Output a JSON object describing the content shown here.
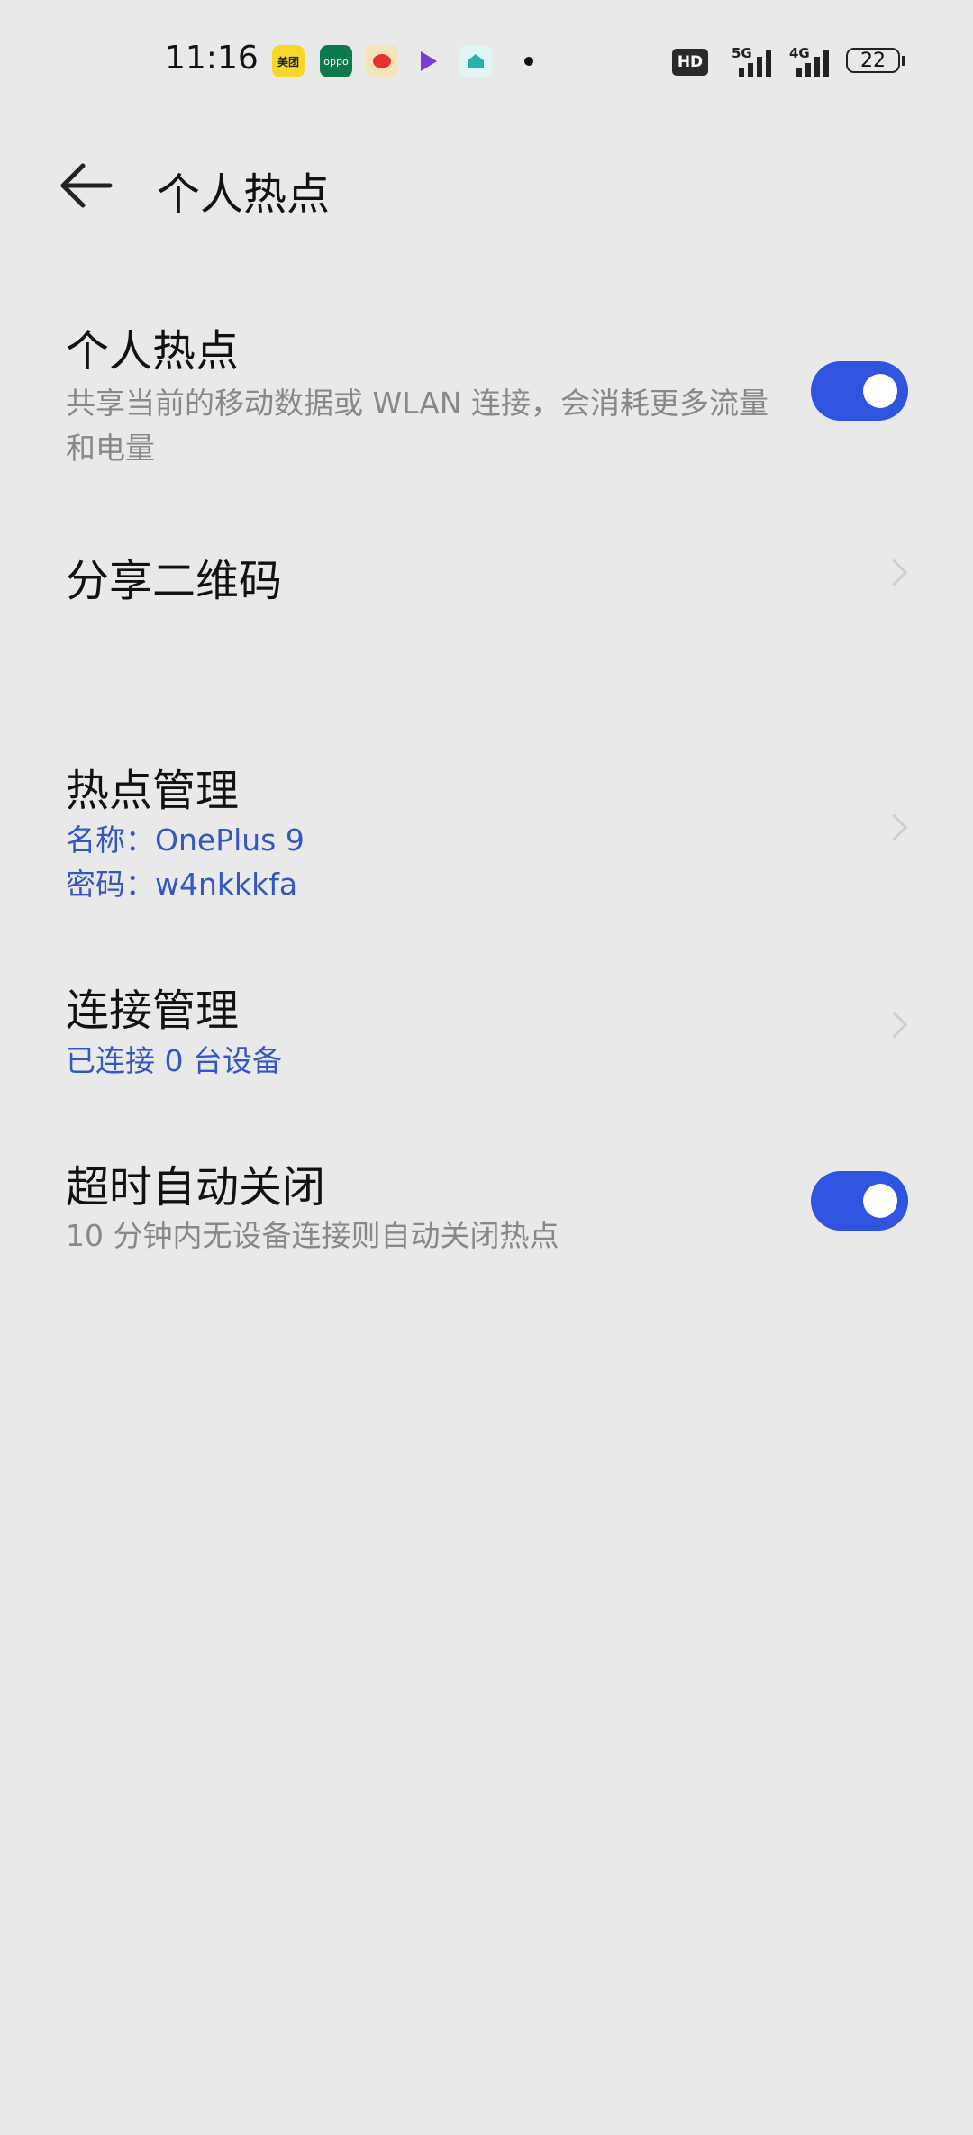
{
  "status_bar": {
    "time": "11:16",
    "notifications": [
      {
        "icon": "meituan-icon",
        "label": "美团"
      },
      {
        "icon": "oppo-icon",
        "label": "oppo"
      },
      {
        "icon": "weibo-icon"
      },
      {
        "icon": "app-icon"
      },
      {
        "icon": "home-app-icon"
      }
    ],
    "hd_label": "HD",
    "signal_1": "5G",
    "signal_2": "4G",
    "battery": "22"
  },
  "header": {
    "title": "个人热点"
  },
  "hotspot": {
    "title": "个人热点",
    "description": "共享当前的移动数据或 WLAN 连接，会消耗更多流量和电量",
    "enabled": true
  },
  "share_qr": {
    "title": "分享二维码"
  },
  "hotspot_management": {
    "title": "热点管理",
    "name_line": "名称：OnePlus 9",
    "password_line": "密码：w4nkkkfa"
  },
  "connection_management": {
    "title": "连接管理",
    "status": "已连接 0 台设备"
  },
  "auto_off": {
    "title": "超时自动关闭",
    "description": "10 分钟内无设备连接则自动关闭热点",
    "enabled": true
  },
  "colors": {
    "accent": "#2f54e0",
    "link_blue": "#3557c2",
    "background": "#e9e9e9"
  }
}
